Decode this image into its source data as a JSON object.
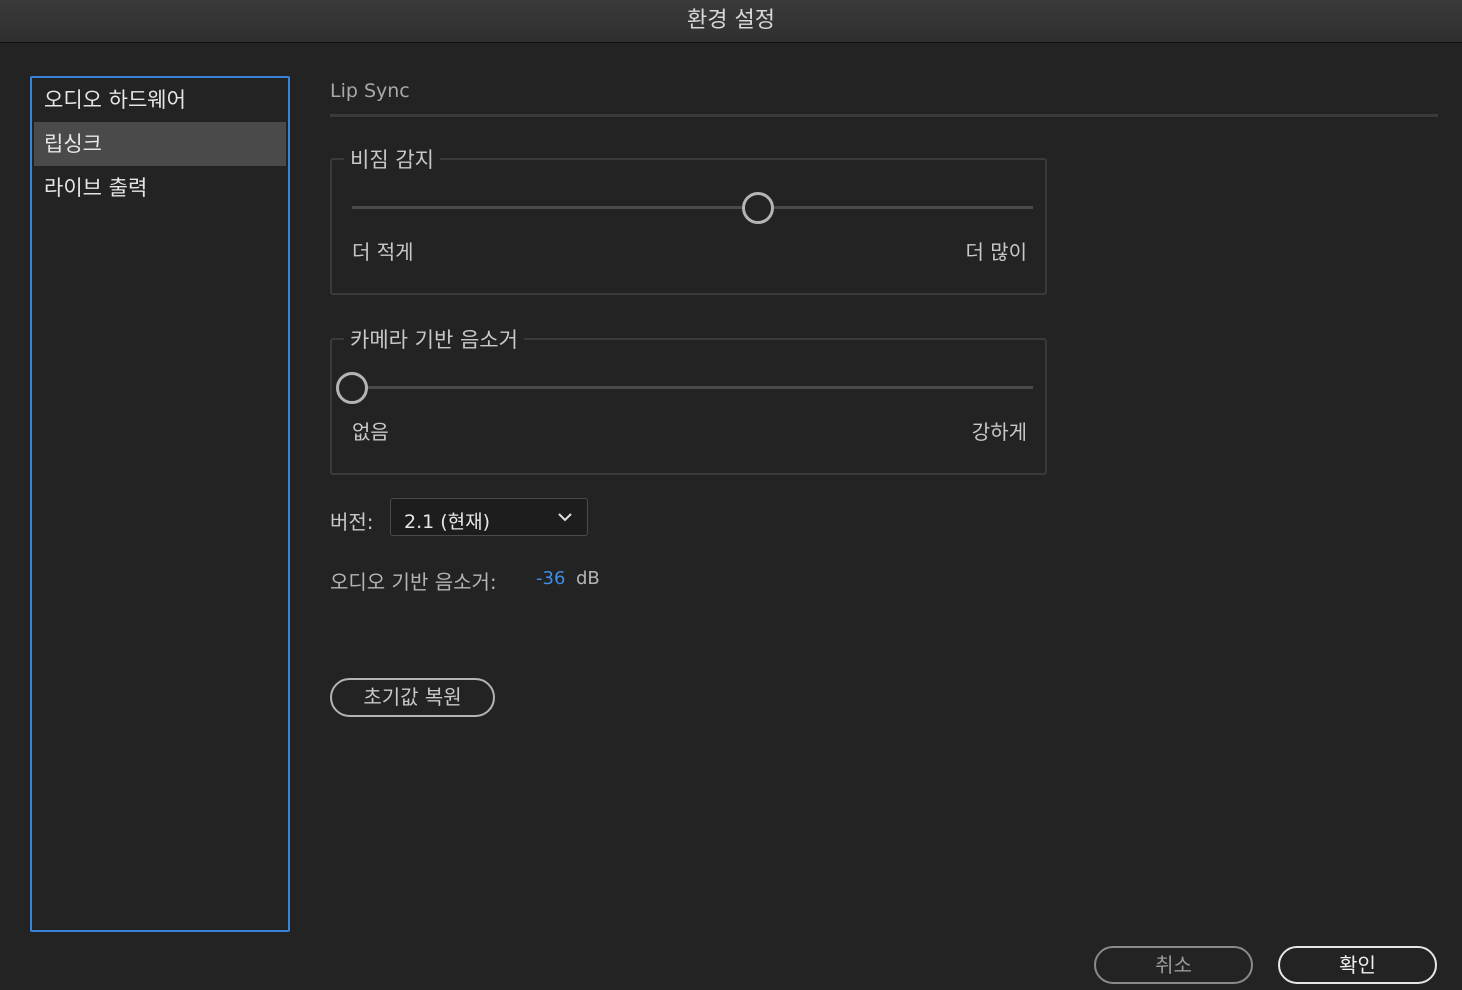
{
  "window": {
    "title": "환경 설정"
  },
  "sidebar": {
    "items": [
      {
        "label": "오디오 하드웨어"
      },
      {
        "label": "립싱크",
        "selected": true
      },
      {
        "label": "라이브 출력"
      }
    ]
  },
  "main": {
    "section_title": "Lip Sync",
    "silence_detection": {
      "legend": "비짐 감지",
      "left_label": "더 적게",
      "right_label": "더 많이",
      "level": 0.6
    },
    "camera_mute": {
      "legend": "카메라 기반 음소거",
      "left_label": "없음",
      "right_label": "강하게",
      "level": 0.0
    },
    "version": {
      "label": "버전:",
      "value": "2.1 (현재)"
    },
    "audio_mute": {
      "label": "오디오 기반 음소거:",
      "value": "-36",
      "unit": "dB"
    },
    "reset_label": "초기값 복원"
  },
  "footer": {
    "cancel_label": "취소",
    "ok_label": "확인"
  },
  "colors": {
    "accent": "#3b82d9",
    "value_blue": "#3d8ee8",
    "background": "#232323"
  }
}
